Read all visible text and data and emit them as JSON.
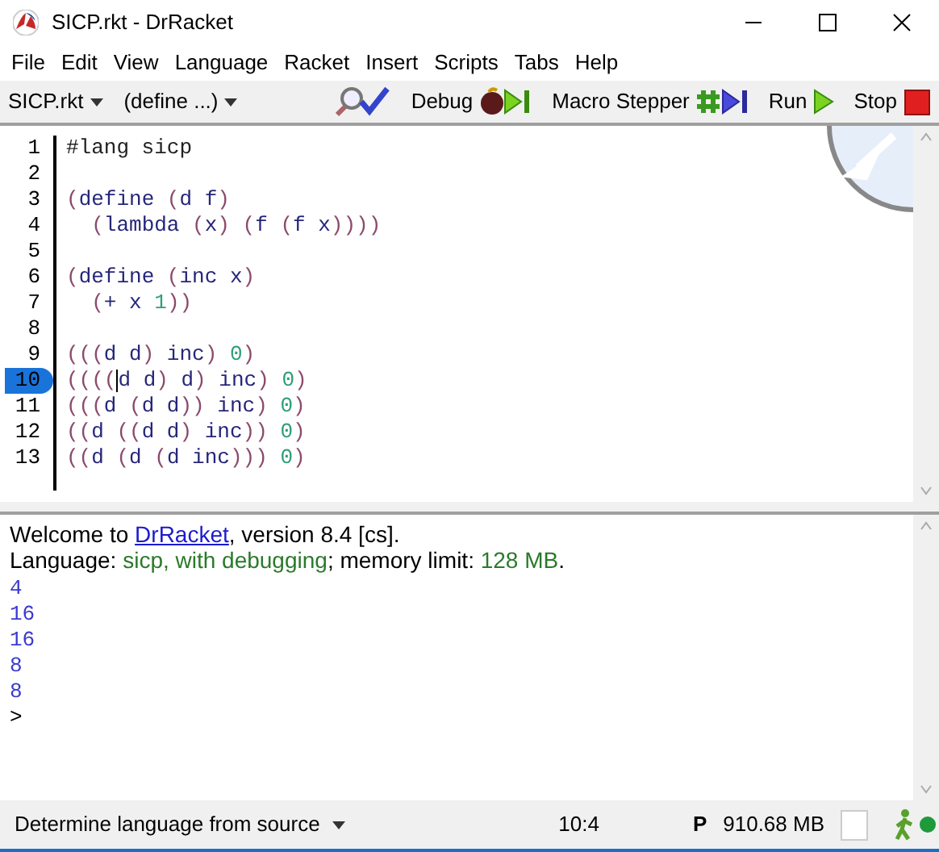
{
  "window": {
    "title": "SICP.rkt - DrRacket"
  },
  "menu": [
    "File",
    "Edit",
    "View",
    "Language",
    "Racket",
    "Insert",
    "Scripts",
    "Tabs",
    "Help"
  ],
  "toolbar": {
    "file_menu": "SICP.rkt",
    "define_menu": "(define ...)",
    "debug": "Debug",
    "macro_stepper": "Macro Stepper",
    "run": "Run",
    "stop": "Stop"
  },
  "editor": {
    "lines": [
      {
        "number": "1",
        "kind": "lang",
        "text": "#lang sicp",
        "selected": false
      },
      {
        "number": "2",
        "selected": false
      },
      {
        "number": "3",
        "kind": "code",
        "text": "(define (d f)",
        "selected": false
      },
      {
        "number": "4",
        "kind": "code",
        "text": "  (lambda (x) (f (f x))))",
        "selected": false
      },
      {
        "number": "5",
        "selected": false
      },
      {
        "number": "6",
        "kind": "code",
        "text": "(define (inc x)",
        "selected": false
      },
      {
        "number": "7",
        "kind": "code",
        "text": "  (+ x 1))",
        "selected": false
      },
      {
        "number": "8",
        "selected": false
      },
      {
        "number": "9",
        "kind": "code",
        "text": "(((d d) inc) 0)",
        "selected": false
      },
      {
        "number": "10",
        "kind": "code",
        "text": "((((",
        "after_cursor": "d d) d) inc) 0)",
        "selected": true
      },
      {
        "number": "11",
        "kind": "code",
        "text": "(((d (d d)) inc) 0)",
        "selected": false
      },
      {
        "number": "12",
        "kind": "code",
        "text": "((d ((d d) inc)) 0)",
        "selected": false
      },
      {
        "number": "13",
        "kind": "code",
        "text": "((d (d (d inc))) 0)",
        "selected": false
      }
    ]
  },
  "repl": {
    "welcome_before": "Welcome to ",
    "welcome_link": "DrRacket",
    "welcome_after": ", version 8.4 [cs].",
    "language_label": "Language: ",
    "language_value": "sicp, with debugging",
    "memory_label": "; memory limit: ",
    "memory_value": "128 MB",
    "memory_end": ".",
    "results": [
      "4",
      "16",
      "16",
      "8",
      "8"
    ],
    "prompt": ">"
  },
  "status_bar": {
    "language": "Determine language from source",
    "position": "10:4",
    "p_label": "P",
    "memory": "910.68 MB"
  }
}
